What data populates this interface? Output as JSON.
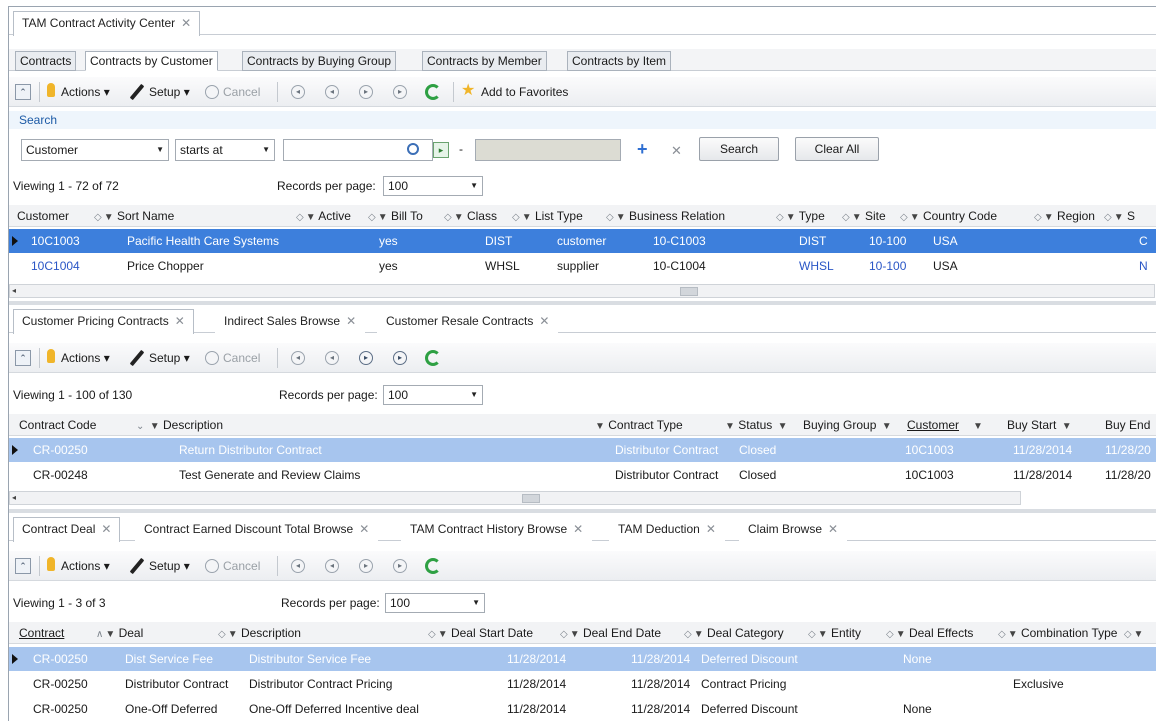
{
  "main_tab": {
    "label": "TAM Contract Activity Center"
  },
  "sub_tabs": [
    "Contracts",
    "Contracts by Customer",
    "Contracts by Buying Group",
    "Contracts by Member",
    "Contracts by Item"
  ],
  "toolbar": {
    "actions": "Actions",
    "setup": "Setup",
    "cancel": "Cancel",
    "favorites": "Add to Favorites"
  },
  "search": {
    "title": "Search",
    "field": "Customer",
    "operator": "starts at",
    "value": "",
    "search_button": "Search",
    "clear_button": "Clear All",
    "dash": "-"
  },
  "customers": {
    "viewing": "Viewing 1 - 72 of 72",
    "records_label": "Records per page:",
    "records_value": "100",
    "columns": [
      "Customer",
      "Sort Name",
      "Active",
      "Bill To",
      "Class",
      "List Type",
      "Business Relation",
      "Type",
      "Site",
      "Country Code",
      "Region",
      "S"
    ],
    "rows": [
      {
        "customer": "10C1003",
        "sort_name": "Pacific Health Care Systems",
        "active": "yes",
        "class": "DIST",
        "list_type": "customer",
        "business_relation": "10-C1003",
        "type": "DIST",
        "site": "10-100",
        "country": "USA",
        "extra": "C"
      },
      {
        "customer": "10C1004",
        "sort_name": "Price Chopper",
        "active": "yes",
        "class": "WHSL",
        "list_type": "supplier",
        "business_relation": "10-C1004",
        "type": "WHSL",
        "site": "10-100",
        "country": "USA",
        "extra": "N"
      }
    ]
  },
  "contract_tabs": [
    "Customer Pricing Contracts",
    "Indirect Sales Browse",
    "Customer Resale Contracts"
  ],
  "contracts": {
    "viewing": "Viewing 1 - 100 of 130",
    "records_label": "Records per page:",
    "records_value": "100",
    "columns": [
      "Contract Code",
      "Description",
      "Contract Type",
      "Status",
      "Buying Group",
      "Customer",
      "Buy Start",
      "Buy End"
    ],
    "rows": [
      {
        "code": "CR-00250",
        "description": "Return Distributor Contract",
        "type": "Distributor Contract",
        "status": "Closed",
        "customer": "10C1003",
        "buy_start": "11/28/2014",
        "buy_end": "11/28/20"
      },
      {
        "code": "CR-00248",
        "description": "Test Generate and Review Claims",
        "type": "Distributor Contract",
        "status": "Closed",
        "customer": "10C1003",
        "buy_start": "11/28/2014",
        "buy_end": "11/28/20"
      }
    ]
  },
  "deal_tabs": [
    "Contract Deal",
    "Contract Earned Discount Total Browse",
    "TAM Contract History Browse",
    "TAM Deduction",
    "Claim Browse"
  ],
  "deals": {
    "viewing": "Viewing 1 - 3 of 3",
    "records_label": "Records per page:",
    "records_value": "100",
    "columns": [
      "Contract",
      "Deal",
      "Description",
      "Deal Start Date",
      "Deal End Date",
      "Deal Category",
      "Entity",
      "Deal Effects",
      "Combination Type"
    ],
    "rows": [
      {
        "contract": "CR-00250",
        "deal": "Dist Service Fee",
        "description": "Distributor Service Fee",
        "start": "11/28/2014",
        "end": "11/28/2014",
        "category": "Deferred Discount",
        "effects": "None",
        "combo": ""
      },
      {
        "contract": "CR-00250",
        "deal": "Distributor Contract",
        "description": "Distributor Contract Pricing",
        "start": "11/28/2014",
        "end": "11/28/2014",
        "category": "Contract Pricing",
        "effects": "",
        "combo": "Exclusive"
      },
      {
        "contract": "CR-00250",
        "deal": "One-Off Deferred",
        "description": "One-Off Deferred Incentive deal",
        "start": "11/28/2014",
        "end": "11/28/2014",
        "category": "Deferred Discount",
        "effects": "None",
        "combo": ""
      }
    ]
  },
  "icons": {
    "collapse": "collapse-icon",
    "bulb": "lightbulb-icon",
    "pen": "pen-icon",
    "cancel": "cancel-circle-icon",
    "first": "first-page-icon",
    "prev": "prev-page-icon",
    "next": "next-page-icon",
    "last": "last-page-icon",
    "refresh": "refresh-icon",
    "star": "star-icon"
  },
  "colors": {
    "selected_row": "#3d7fdc",
    "selected_row_light": "#a7c5ee",
    "link": "#2a56c6",
    "search_bar": "#eef5fc"
  }
}
